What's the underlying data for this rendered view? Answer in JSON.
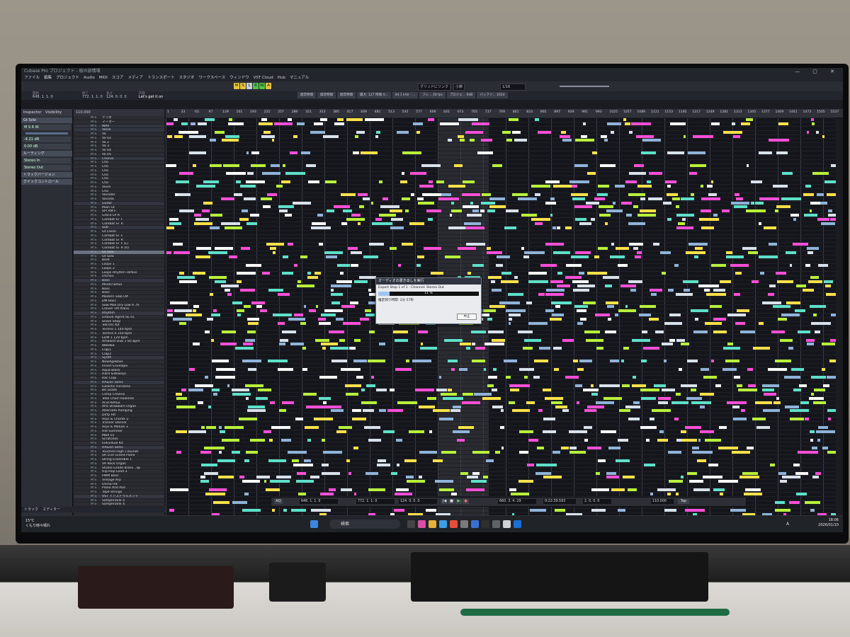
{
  "app": {
    "title": "Cubase Pro プロジェクト - 桜の旅情場",
    "window_buttons": "— ▢ ✕"
  },
  "menu": [
    "ファイル",
    "編集",
    "プロジェクト",
    "Audio",
    "MIDI",
    "スコア",
    "メディア",
    "トランスポート",
    "スタジオ",
    "ワークスペース",
    "ウィンドウ",
    "VST Cloud",
    "Hub",
    "マニュアル"
  ],
  "toolbar": {
    "modes": [
      {
        "label": "M",
        "color": "#e7c23c"
      },
      {
        "label": "S",
        "color": "#e7c23c"
      },
      {
        "label": "L",
        "color": "#c9d0d8"
      },
      {
        "label": "R",
        "color": "#53c247"
      },
      {
        "label": "W",
        "color": "#53c247"
      },
      {
        "label": "A",
        "color": "#e7c23c"
      }
    ],
    "snap_label": "グリッドにリンク",
    "grid_label": "小節",
    "quantize_label": "1/16"
  },
  "info_line": {
    "start_label": "開始",
    "start_value": "648. 1. 1. 0",
    "end_label": "終了",
    "end_value": "772. 1. 1. 0",
    "length_label": "長さ",
    "length_value": "124. 0. 0. 0",
    "content_label": "内容",
    "content_value": "Let's get it on"
  },
  "status_buttons": [
    "録音時間",
    "録音時間",
    "録音時間",
    "最大: 127 時間 4...",
    "44.1 kHz - ...",
    "フレ... 30 fps",
    "プロジェ... 0dB",
    "バッファ... 1024"
  ],
  "inspector": {
    "tab_inspector": "Inspector",
    "tab_visibility": "Visibility",
    "track_name": "Gt Solo",
    "volume": "-4.21 dB",
    "pan": "0.00 dB",
    "sections": [
      "ルーティング",
      "トラックバージョン",
      "クイックコントロール"
    ],
    "routing_value": "Stereo In",
    "routing_out": "Stereo Out"
  },
  "tracklist_header": "110.000",
  "tracks": [
    {
      "name": "テンポ",
      "folder": false
    },
    {
      "name": "マーカー",
      "folder": false
    },
    {
      "name": "WAV",
      "folder": true
    },
    {
      "name": "Vocal",
      "folder": true
    },
    {
      "name": "Vo",
      "folder": false
    },
    {
      "name": "Vo 02",
      "folder": false
    },
    {
      "name": "Vo 2",
      "folder": false
    },
    {
      "name": "Vo 3",
      "folder": false
    },
    {
      "name": "Vo 04",
      "folder": false
    },
    {
      "name": "Vo 05",
      "folder": false
    },
    {
      "name": "Chorus",
      "folder": true
    },
    {
      "name": "Cho",
      "folder": false
    },
    {
      "name": "Cho",
      "folder": false
    },
    {
      "name": "Cho",
      "folder": false
    },
    {
      "name": "Cho",
      "folder": false
    },
    {
      "name": "Cho",
      "folder": false
    },
    {
      "name": "Cho",
      "folder": false
    },
    {
      "name": "Voice",
      "folder": false
    },
    {
      "name": "Cho",
      "folder": false
    },
    {
      "name": "Vocoder",
      "folder": false
    },
    {
      "name": "Vocoda",
      "folder": false
    },
    {
      "name": "Guitar",
      "folder": true
    },
    {
      "name": "Main Gt",
      "folder": false
    },
    {
      "name": "SPI AM F",
      "folder": false
    },
    {
      "name": "Greco LP R",
      "folder": false
    },
    {
      "name": "Combat ST F",
      "folder": false
    },
    {
      "name": "Combat ST R",
      "folder": false
    },
    {
      "name": "Sub",
      "folder": true
    },
    {
      "name": "Gt Clean",
      "folder": false
    },
    {
      "name": "Combat ST F",
      "folder": false
    },
    {
      "name": "Combat ST R",
      "folder": false
    },
    {
      "name": "Combat ST F (L)",
      "folder": false
    },
    {
      "name": "Combat ST R (R)",
      "folder": false
    },
    {
      "name": "Gt Solo",
      "folder": false,
      "hl": true
    },
    {
      "name": "Gt Solo",
      "folder": false
    },
    {
      "name": "Beat",
      "folder": false
    },
    {
      "name": "Loops 1",
      "folder": false
    },
    {
      "name": "Loops 2",
      "folder": false
    },
    {
      "name": "Loops Rhythm HiPass",
      "folder": false
    },
    {
      "name": "Orcha1",
      "folder": false
    },
    {
      "name": "Bass",
      "folder": true
    },
    {
      "name": "MODO BASS",
      "folder": false
    },
    {
      "name": "Bass",
      "folder": false
    },
    {
      "name": "Bass",
      "folder": false
    },
    {
      "name": "Modern Slab LM",
      "folder": false
    },
    {
      "name": "DM Bass",
      "folder": false
    },
    {
      "name": "Saw Max Dry Low R..rk",
      "folder": false
    },
    {
      "name": "Clavier FM Piano",
      "folder": false
    },
    {
      "name": "Rhythm",
      "folder": true
    },
    {
      "name": "Groove Agent SE 01",
      "folder": false
    },
    {
      "name": "Snare Shop",
      "folder": false
    },
    {
      "name": "TekTrnc Kit",
      "folder": false
    },
    {
      "name": "Techno 1 140 bpm",
      "folder": false
    },
    {
      "name": "Techno 4 150 bpm",
      "folder": false
    },
    {
      "name": "EDM 1 129 bpm",
      "folder": false
    },
    {
      "name": "Ambient Dub 1 85 bpm",
      "folder": false
    },
    {
      "name": "Bbbaba",
      "folder": false
    },
    {
      "name": "Clap1",
      "folder": false
    },
    {
      "name": "Clap2",
      "folder": false
    },
    {
      "name": "Synth",
      "folder": true
    },
    {
      "name": "NewAgeBass",
      "folder": false
    },
    {
      "name": "Invert Envelope",
      "folder": false
    },
    {
      "name": "Aqua Block",
      "folder": false
    },
    {
      "name": "Hard Sideways",
      "folder": false
    },
    {
      "name": "Rac Clap",
      "folder": false
    },
    {
      "name": "HALion Sonic",
      "folder": true
    },
    {
      "name": "Galactic Horizons",
      "folder": false
    },
    {
      "name": "Bit Leads",
      "folder": false
    },
    {
      "name": "Comp Chassis",
      "folder": false
    },
    {
      "name": "Tekk Choir Hookline",
      "folder": false
    },
    {
      "name": "Acid Reflux",
      "folder": false
    },
    {
      "name": "Afro Drawbars Organ",
      "folder": false
    },
    {
      "name": "Alternate Pumping",
      "folder": false
    },
    {
      "name": "Dirty Hit",
      "folder": false
    },
    {
      "name": "Arps & Chords 2",
      "folder": false
    },
    {
      "name": "Trancer Dancer",
      "folder": false
    },
    {
      "name": "Arps & Motion 3",
      "folder": false
    },
    {
      "name": "Hot Summer",
      "folder": false
    },
    {
      "name": "MBX 01",
      "folder": false
    },
    {
      "name": "Scratches",
      "folder": false
    },
    {
      "name": "Individual Kit",
      "folder": false
    },
    {
      "name": "HALion Sonic",
      "folder": true
    },
    {
      "name": "Touched High Clavinet",
      "folder": false
    },
    {
      "name": "SR Live Grand Piano",
      "folder": false
    },
    {
      "name": "String Ensemble 1",
      "folder": false
    },
    {
      "name": "VA Rock Organ",
      "folder": false
    },
    {
      "name": "Studio Grade Brass ..xp",
      "folder": false
    },
    {
      "name": "Hip-Hop Lead 3",
      "folder": false
    },
    {
      "name": "PWM Bass",
      "folder": false
    },
    {
      "name": "Vintage Arp",
      "folder": false
    },
    {
      "name": "Orcha Hit",
      "folder": false
    },
    {
      "name": "Piano And Pad",
      "folder": false
    },
    {
      "name": "Tape Strings",
      "folder": false
    },
    {
      "name": "VST インストゥルメント",
      "folder": true
    },
    {
      "name": "SampleTank 4",
      "folder": false
    },
    {
      "name": "SampleTank 4",
      "folder": false
    }
  ],
  "ruler": [
    "1",
    "33",
    "65",
    "97",
    "129",
    "161",
    "193",
    "225",
    "257",
    "289",
    "321",
    "353",
    "385",
    "417",
    "449",
    "481",
    "513",
    "545",
    "577",
    "609",
    "641",
    "673",
    "705",
    "737",
    "769",
    "801",
    "833",
    "865",
    "897",
    "929",
    "961",
    "993",
    "1025",
    "1057",
    "1089",
    "1121",
    "1153",
    "1185",
    "1217",
    "1249",
    "1281",
    "1313",
    "1345",
    "1377",
    "1409",
    "1441",
    "1473",
    "1505",
    "1537"
  ],
  "region_colors": [
    "#ff4fd8",
    "#b8f03a",
    "#ffe14a",
    "#d9e1ea",
    "#8fb3d9",
    "#5fe0c8",
    "#ffffff"
  ],
  "dialog": {
    "title": "オーディオの書き出しを実行",
    "step": "Export Step 1 of 1 - Channel: Stereo Out",
    "progress": 11,
    "progress_label": "11 %",
    "remaining_label": "推定残り時間:",
    "remaining_value": "2分 57秒",
    "cancel": "中止"
  },
  "transport": {
    "aq": "AQ",
    "left_locator": "648. 1. 1. 0",
    "right_locator": "772. 1. 1. 0",
    "length": "124. 0. 0. 0",
    "position": "660. 3. 4. 29",
    "time": "0:22:39.593",
    "tempo": "110.000",
    "tap": "Tap",
    "signature": "2. 0. 0. 0"
  },
  "bottom_tabs": {
    "track": "トラック",
    "editor": "エディター"
  },
  "taskbar": {
    "weather_temp": "15°C",
    "weather_desc": "くもり時々晴れ",
    "search": "検索",
    "time": "18:06",
    "date": "2026/01/10",
    "lang": "A"
  }
}
